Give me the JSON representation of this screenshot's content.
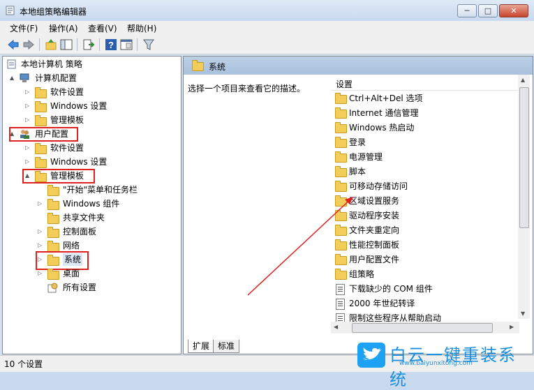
{
  "window": {
    "title": "本地组策略编辑器",
    "minimize": "─",
    "maximize": "□",
    "close": "✕"
  },
  "menu": [
    "文件(F)",
    "操作(A)",
    "查看(V)",
    "帮助(H)"
  ],
  "toolbar_icons": [
    "back-icon",
    "forward-icon",
    "up-folder-icon",
    "show-tree-icon",
    "export-icon",
    "help-icon",
    "properties-icon",
    "filter-icon"
  ],
  "tree": {
    "root": "本地计算机 策略",
    "items": [
      {
        "label": "计算机配置",
        "level": 1,
        "twisty": "▲"
      },
      {
        "label": "软件设置",
        "level": 2,
        "twisty": "▷"
      },
      {
        "label": "Windows 设置",
        "level": 2,
        "twisty": "▷"
      },
      {
        "label": "管理模板",
        "level": 2,
        "twisty": "▷"
      },
      {
        "label": "用户配置",
        "level": 1,
        "twisty": "▲"
      },
      {
        "label": "软件设置",
        "level": 2,
        "twisty": "▷"
      },
      {
        "label": "Windows 设置",
        "level": 2,
        "twisty": "▷"
      },
      {
        "label": "管理模板",
        "level": 2,
        "twisty": "▲"
      },
      {
        "label": "\"开始\"菜单和任务栏",
        "level": 3,
        "twisty": ""
      },
      {
        "label": "Windows 组件",
        "level": 3,
        "twisty": "▷"
      },
      {
        "label": "共享文件夹",
        "level": 3,
        "twisty": ""
      },
      {
        "label": "控制面板",
        "level": 3,
        "twisty": "▷"
      },
      {
        "label": "网络",
        "level": 3,
        "twisty": "▷"
      },
      {
        "label": "系统",
        "level": 3,
        "twisty": "▷"
      },
      {
        "label": "桌面",
        "level": 3,
        "twisty": "▷"
      },
      {
        "label": "所有设置",
        "level": 3,
        "twisty": ""
      }
    ]
  },
  "right_panel": {
    "header": "系统",
    "description": "选择一个项目来查看它的描述。",
    "column_header": "设置",
    "items": [
      {
        "label": "Ctrl+Alt+Del 选项",
        "type": "folder"
      },
      {
        "label": "Internet 通信管理",
        "type": "folder"
      },
      {
        "label": "Windows 热启动",
        "type": "folder"
      },
      {
        "label": "登录",
        "type": "folder"
      },
      {
        "label": "电源管理",
        "type": "folder"
      },
      {
        "label": "脚本",
        "type": "folder"
      },
      {
        "label": "可移动存储访问",
        "type": "folder"
      },
      {
        "label": "区域设置服务",
        "type": "folder"
      },
      {
        "label": "驱动程序安装",
        "type": "folder"
      },
      {
        "label": "文件夹重定向",
        "type": "folder"
      },
      {
        "label": "性能控制面板",
        "type": "folder"
      },
      {
        "label": "用户配置文件",
        "type": "folder"
      },
      {
        "label": "组策略",
        "type": "folder"
      },
      {
        "label": "下载缺少的 COM 组件",
        "type": "policy"
      },
      {
        "label": "2000 年世纪转译",
        "type": "policy"
      },
      {
        "label": "限制这些程序从帮助启动",
        "type": "policy"
      }
    ]
  },
  "tabs": [
    "扩展",
    "标准"
  ],
  "status": "10 个设置",
  "watermark": {
    "name": "白云一键重装系统",
    "url": "www.baiyunxitong.com"
  },
  "colors": {
    "highlight_box": "#e01f1f",
    "arrow": "#e01f1f",
    "folder": "#f3cd5a",
    "header": "#a9c1dc"
  }
}
